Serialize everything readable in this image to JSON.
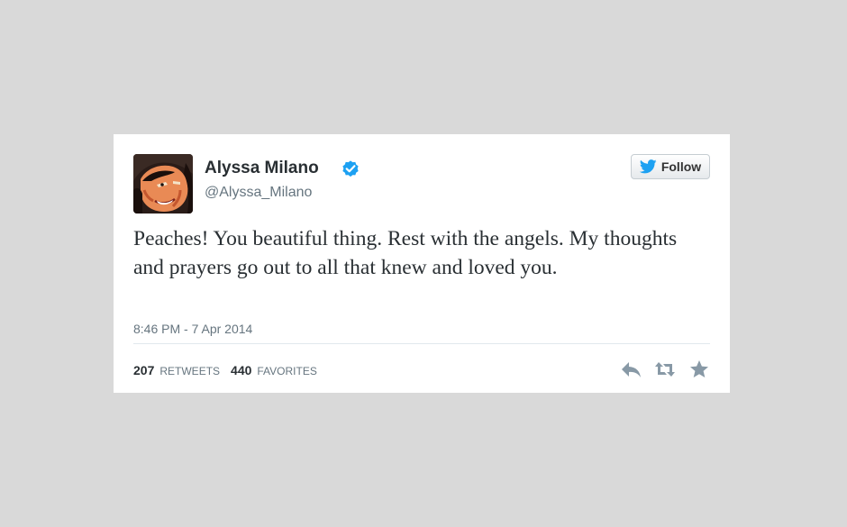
{
  "tweet": {
    "display_name": "Alyssa Milano",
    "screen_name": "@Alyssa_Milano",
    "verified_icon": "verified-badge-icon",
    "avatar_icon": "avatar-illustration",
    "follow_label": "Follow",
    "text": "Peaches! You beautiful thing. Rest with the angels. My thoughts and prayers go out to all that knew and loved you.",
    "timestamp": "8:46 PM - 7 Apr 2014",
    "stats": {
      "retweets_count": "207",
      "retweets_label": "RETWEETS",
      "favorites_count": "440",
      "favorites_label": "FAVORITES"
    },
    "actions": [
      "reply-icon",
      "retweet-icon",
      "favorite-icon"
    ]
  },
  "colors": {
    "background": "#d9d9d9",
    "card": "#ffffff",
    "twitter_blue": "#1da1f2",
    "text": "#292f33",
    "muted": "#66757f",
    "icon_gray": "#8899a6"
  }
}
